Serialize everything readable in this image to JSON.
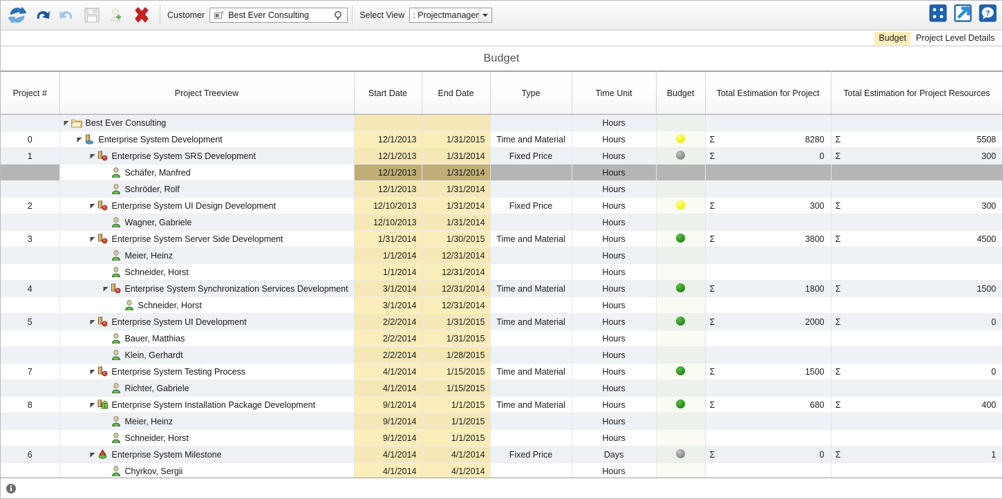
{
  "toolbar": {
    "icons": [
      {
        "name": "refresh-icon",
        "label": "Refresh"
      },
      {
        "name": "undo-icon",
        "label": "Undo"
      },
      {
        "name": "redo-icon",
        "label": "Redo"
      },
      {
        "name": "save-icon",
        "label": "Save"
      },
      {
        "name": "add-user-icon",
        "label": "Add User"
      },
      {
        "name": "delete-icon",
        "label": "Delete"
      }
    ],
    "customer_label": "Customer",
    "customer_value": "Best Ever Consulting",
    "select_view_label": "Select View",
    "select_view_value": ": Projectmanager",
    "right_icons": [
      {
        "name": "grid-view-icon",
        "label": "Grid View"
      },
      {
        "name": "export-icon",
        "label": "Export"
      },
      {
        "name": "help-icon",
        "label": "Help"
      }
    ]
  },
  "tabs": [
    {
      "label": "Budget",
      "active": true
    },
    {
      "label": "Project Level Details",
      "active": false
    }
  ],
  "title": "Budget",
  "columns": [
    "Project #",
    "Project Treeview",
    "Start Date",
    "End Date",
    "Type",
    "Time Unit",
    "Budget",
    "Total Estimation for Project",
    "Total Estimation for Project Resources"
  ],
  "sigma": "Σ",
  "rows": [
    {
      "num": "",
      "indent": 0,
      "expander": "expanded",
      "icon": "folder-icon",
      "label": "Best Ever Consulting",
      "start": "",
      "end": "",
      "type": "",
      "unit": "Hours",
      "budget": "",
      "est": "",
      "res": "",
      "band": "B",
      "selected": false
    },
    {
      "num": "0",
      "indent": 1,
      "expander": "expanded",
      "icon": "project-icon",
      "label": "Enterprise System Development",
      "start": "12/1/2013",
      "end": "1/31/2015",
      "type": "Time and Material",
      "unit": "Hours",
      "budget": "yellow",
      "est": "8280",
      "res": "5508",
      "band": "A",
      "selected": false
    },
    {
      "num": "1",
      "indent": 2,
      "expander": "expanded",
      "icon": "subproject-icon",
      "label": "Enterprise System SRS Development",
      "start": "12/1/2013",
      "end": "1/31/2014",
      "type": "Fixed Price",
      "unit": "Hours",
      "budget": "gray",
      "est": "0",
      "res": "300",
      "band": "B",
      "selected": false
    },
    {
      "num": "",
      "indent": 3,
      "expander": "none",
      "icon": "person-icon",
      "label": "Schäfer, Manfred",
      "start": "12/1/2013",
      "end": "1/31/2014",
      "type": "",
      "unit": "Hours",
      "budget": "",
      "est": "",
      "res": "",
      "band": "A",
      "selected": true
    },
    {
      "num": "",
      "indent": 3,
      "expander": "none",
      "icon": "person-icon",
      "label": "Schröder, Rolf",
      "start": "12/1/2013",
      "end": "1/31/2014",
      "type": "",
      "unit": "Hours",
      "budget": "",
      "est": "",
      "res": "",
      "band": "B",
      "selected": false
    },
    {
      "num": "2",
      "indent": 2,
      "expander": "expanded",
      "icon": "subproject-icon",
      "label": "Enterprise System UI Design Development",
      "start": "12/10/2013",
      "end": "1/31/2014",
      "type": "Fixed Price",
      "unit": "Hours",
      "budget": "yellow",
      "est": "300",
      "res": "300",
      "band": "A",
      "selected": false
    },
    {
      "num": "",
      "indent": 3,
      "expander": "none",
      "icon": "person-icon",
      "label": "Wagner, Gabriele",
      "start": "12/10/2013",
      "end": "1/31/2014",
      "type": "",
      "unit": "Hours",
      "budget": "",
      "est": "",
      "res": "",
      "band": "B",
      "selected": false
    },
    {
      "num": "3",
      "indent": 2,
      "expander": "expanded",
      "icon": "subproject-icon",
      "label": "Enterprise System Server Side Development",
      "start": "1/31/2014",
      "end": "1/30/2015",
      "type": "Time and Material",
      "unit": "Hours",
      "budget": "green",
      "est": "3800",
      "res": "4500",
      "band": "A",
      "selected": false
    },
    {
      "num": "",
      "indent": 3,
      "expander": "none",
      "icon": "person-icon",
      "label": "Meier, Heinz",
      "start": "1/1/2014",
      "end": "12/31/2014",
      "type": "",
      "unit": "Hours",
      "budget": "",
      "est": "",
      "res": "",
      "band": "B",
      "selected": false
    },
    {
      "num": "",
      "indent": 3,
      "expander": "none",
      "icon": "person-icon",
      "label": "Schneider, Horst",
      "start": "1/1/2014",
      "end": "12/31/2014",
      "type": "",
      "unit": "Hours",
      "budget": "",
      "est": "",
      "res": "",
      "band": "A",
      "selected": false
    },
    {
      "num": "4",
      "indent": 3,
      "expander": "expanded",
      "icon": "subproject-icon",
      "label": "Enterprise System Synchronization Services Development",
      "start": "3/1/2014",
      "end": "12/31/2014",
      "type": "Time and Material",
      "unit": "Hours",
      "budget": "green",
      "est": "1800",
      "res": "1500",
      "band": "B",
      "selected": false
    },
    {
      "num": "",
      "indent": 4,
      "expander": "none",
      "icon": "person-icon",
      "label": "Schneider, Horst",
      "start": "3/1/2014",
      "end": "12/31/2014",
      "type": "",
      "unit": "Hours",
      "budget": "",
      "est": "",
      "res": "",
      "band": "A",
      "selected": false
    },
    {
      "num": "5",
      "indent": 2,
      "expander": "expanded",
      "icon": "subproject-icon",
      "label": "Enterprise System UI Development",
      "start": "2/2/2014",
      "end": "1/31/2015",
      "type": "Time and Material",
      "unit": "Hours",
      "budget": "green",
      "est": "2000",
      "res": "0",
      "band": "B",
      "selected": false
    },
    {
      "num": "",
      "indent": 3,
      "expander": "none",
      "icon": "person-icon",
      "label": "Bauer, Matthias",
      "start": "2/2/2014",
      "end": "1/31/2015",
      "type": "",
      "unit": "Hours",
      "budget": "",
      "est": "",
      "res": "",
      "band": "A",
      "selected": false
    },
    {
      "num": "",
      "indent": 3,
      "expander": "none",
      "icon": "person-icon",
      "label": "Klein, Gerhardt",
      "start": "2/2/2014",
      "end": "1/28/2015",
      "type": "",
      "unit": "Hours",
      "budget": "",
      "est": "",
      "res": "",
      "band": "B",
      "selected": false
    },
    {
      "num": "7",
      "indent": 2,
      "expander": "expanded",
      "icon": "subproject-icon",
      "label": "Enterprise System Testing Process",
      "start": "4/1/2014",
      "end": "1/15/2015",
      "type": "Time and Material",
      "unit": "Hours",
      "budget": "green",
      "est": "1500",
      "res": "0",
      "band": "A",
      "selected": false
    },
    {
      "num": "",
      "indent": 3,
      "expander": "none",
      "icon": "person-icon",
      "label": "Richter, Gabriele",
      "start": "4/1/2014",
      "end": "1/15/2015",
      "type": "",
      "unit": "Hours",
      "budget": "",
      "est": "",
      "res": "",
      "band": "B",
      "selected": false
    },
    {
      "num": "8",
      "indent": 2,
      "expander": "expanded",
      "icon": "package-icon",
      "label": "Enterprise System Installation Package Development",
      "start": "9/1/2014",
      "end": "1/1/2015",
      "type": "Time and Material",
      "unit": "Hours",
      "budget": "green",
      "est": "680",
      "res": "400",
      "band": "A",
      "selected": false
    },
    {
      "num": "",
      "indent": 3,
      "expander": "none",
      "icon": "person-icon",
      "label": "Meier, Heinz",
      "start": "9/1/2014",
      "end": "1/1/2015",
      "type": "",
      "unit": "Hours",
      "budget": "",
      "est": "",
      "res": "",
      "band": "B",
      "selected": false
    },
    {
      "num": "",
      "indent": 3,
      "expander": "none",
      "icon": "person-icon",
      "label": "Schneider, Horst",
      "start": "9/1/2014",
      "end": "1/1/2015",
      "type": "",
      "unit": "Hours",
      "budget": "",
      "est": "",
      "res": "",
      "band": "A",
      "selected": false
    },
    {
      "num": "6",
      "indent": 2,
      "expander": "expanded",
      "icon": "milestone-icon",
      "label": "Enterprise System Milestone",
      "start": "4/1/2014",
      "end": "4/1/2014",
      "type": "Fixed Price",
      "unit": "Days",
      "budget": "gray",
      "est": "0",
      "res": "1",
      "band": "B",
      "selected": false
    },
    {
      "num": "",
      "indent": 3,
      "expander": "none",
      "icon": "person-icon",
      "label": "Chyrkov, Sergii",
      "start": "4/1/2014",
      "end": "4/1/2014",
      "type": "",
      "unit": "Hours",
      "budget": "",
      "est": "",
      "res": "",
      "band": "A",
      "selected": false
    }
  ],
  "statusbar": {
    "icon": "info-icon",
    "text": ""
  },
  "colors": {
    "tab_active_bg": "#fdeeb9",
    "date_cell": "#fbeeba",
    "selected_row": "#b5b5b5",
    "budget_green": "#1f8a16",
    "budget_yellow": "#f3f314",
    "budget_gray": "#8c8c8c"
  }
}
